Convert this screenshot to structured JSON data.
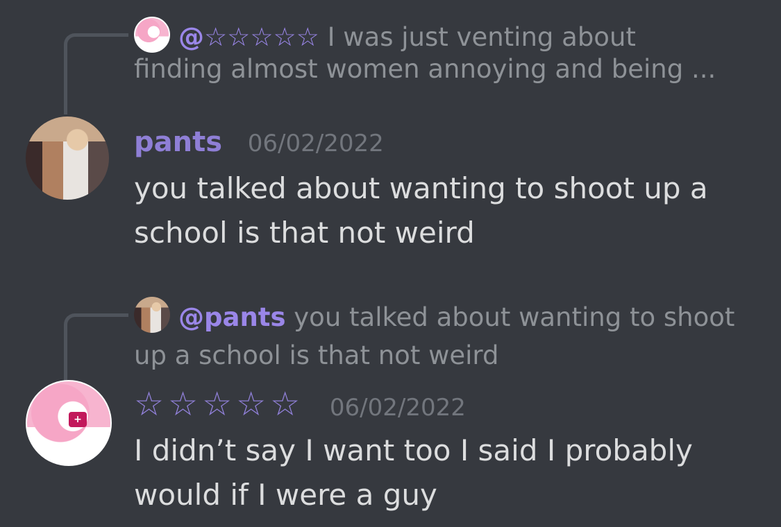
{
  "messages": [
    {
      "reply": {
        "mention": "@☆☆☆☆☆",
        "text": "I was just venting about finding almost women annoying and being ..."
      },
      "author": "pants",
      "timestamp": "06/02/2022",
      "content": "you talked about wanting to shoot up a school is that not weird"
    },
    {
      "reply": {
        "mention": "@pants",
        "text": "you talked about wanting to shoot up a school is that not weird"
      },
      "author": "☆☆☆☆☆",
      "timestamp": "06/02/2022",
      "content": "I didn’t say I want too I said I probably would if I were a guy"
    }
  ],
  "colors": {
    "background": "#36393f",
    "username_accent": "#8f7fd6",
    "mention": "#9a86e8",
    "muted_text": "#8e9297",
    "body_text": "#dcddde"
  }
}
